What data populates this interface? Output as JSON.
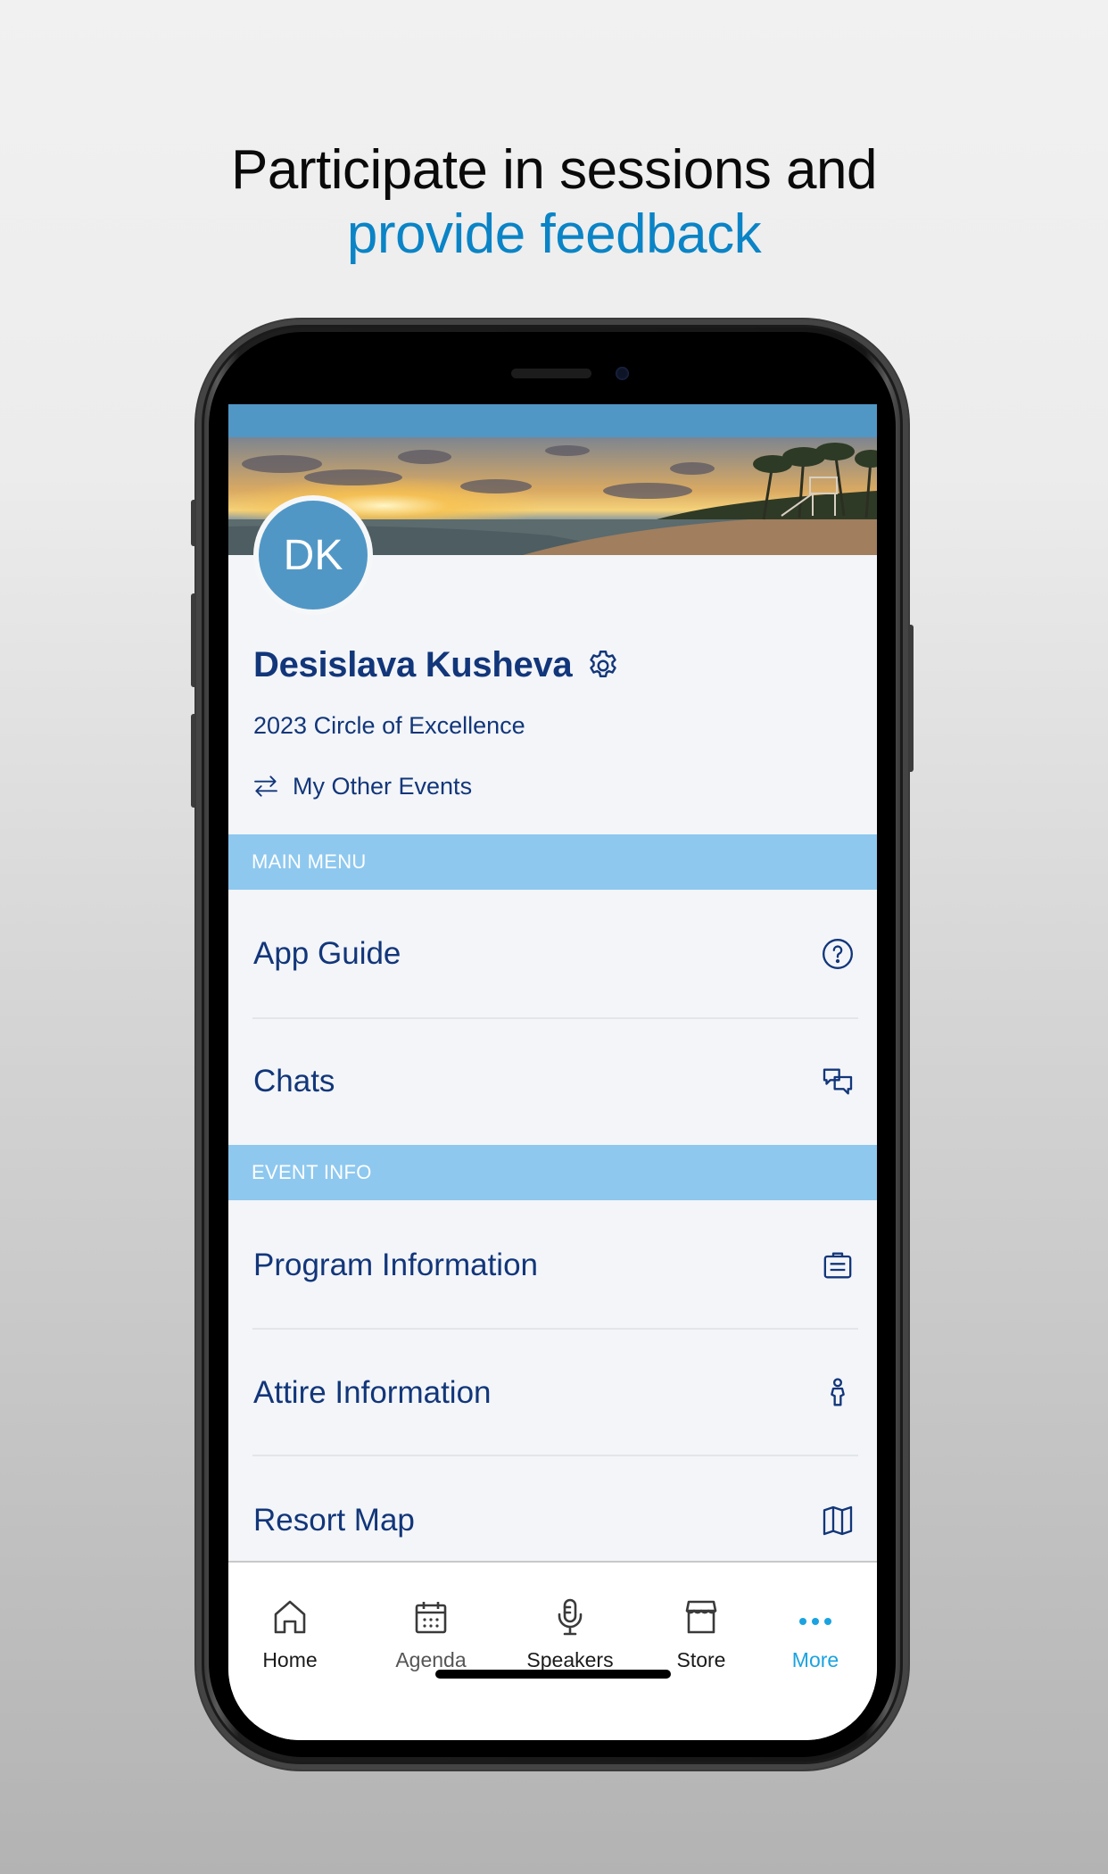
{
  "headline": {
    "line1": "Participate in sessions and",
    "line2": "provide feedback",
    "line2_color": "#0a84c6"
  },
  "profile": {
    "initials": "DK",
    "name": "Desislava Kusheva",
    "event_name": "2023 Circle of Excellence",
    "other_events_label": "My Other Events",
    "settings_icon": "gear-icon",
    "avatar_color": "#5197c6"
  },
  "sections": [
    {
      "title": "MAIN MENU",
      "items": [
        {
          "label": "App Guide",
          "icon": "question-circle-icon"
        },
        {
          "label": "Chats",
          "icon": "chat-bubbles-icon"
        }
      ]
    },
    {
      "title": "EVENT INFO",
      "items": [
        {
          "label": "Program Information",
          "icon": "clipboard-icon"
        },
        {
          "label": "Attire Information",
          "icon": "person-icon"
        },
        {
          "label": "Resort Map",
          "icon": "map-icon"
        }
      ]
    }
  ],
  "tabbar": {
    "items": [
      {
        "label": "Home",
        "icon": "home-icon"
      },
      {
        "label": "Agenda",
        "icon": "calendar-icon"
      },
      {
        "label": "Speakers",
        "icon": "microphone-icon"
      },
      {
        "label": "Store",
        "icon": "store-icon"
      },
      {
        "label": "More",
        "icon": "more-dots-icon",
        "active": true
      }
    ],
    "active_color": "#1aa3e0"
  },
  "colors": {
    "primary_text": "#12367a",
    "section_band": "#8ec8ef",
    "status_bar": "#5197c6"
  }
}
